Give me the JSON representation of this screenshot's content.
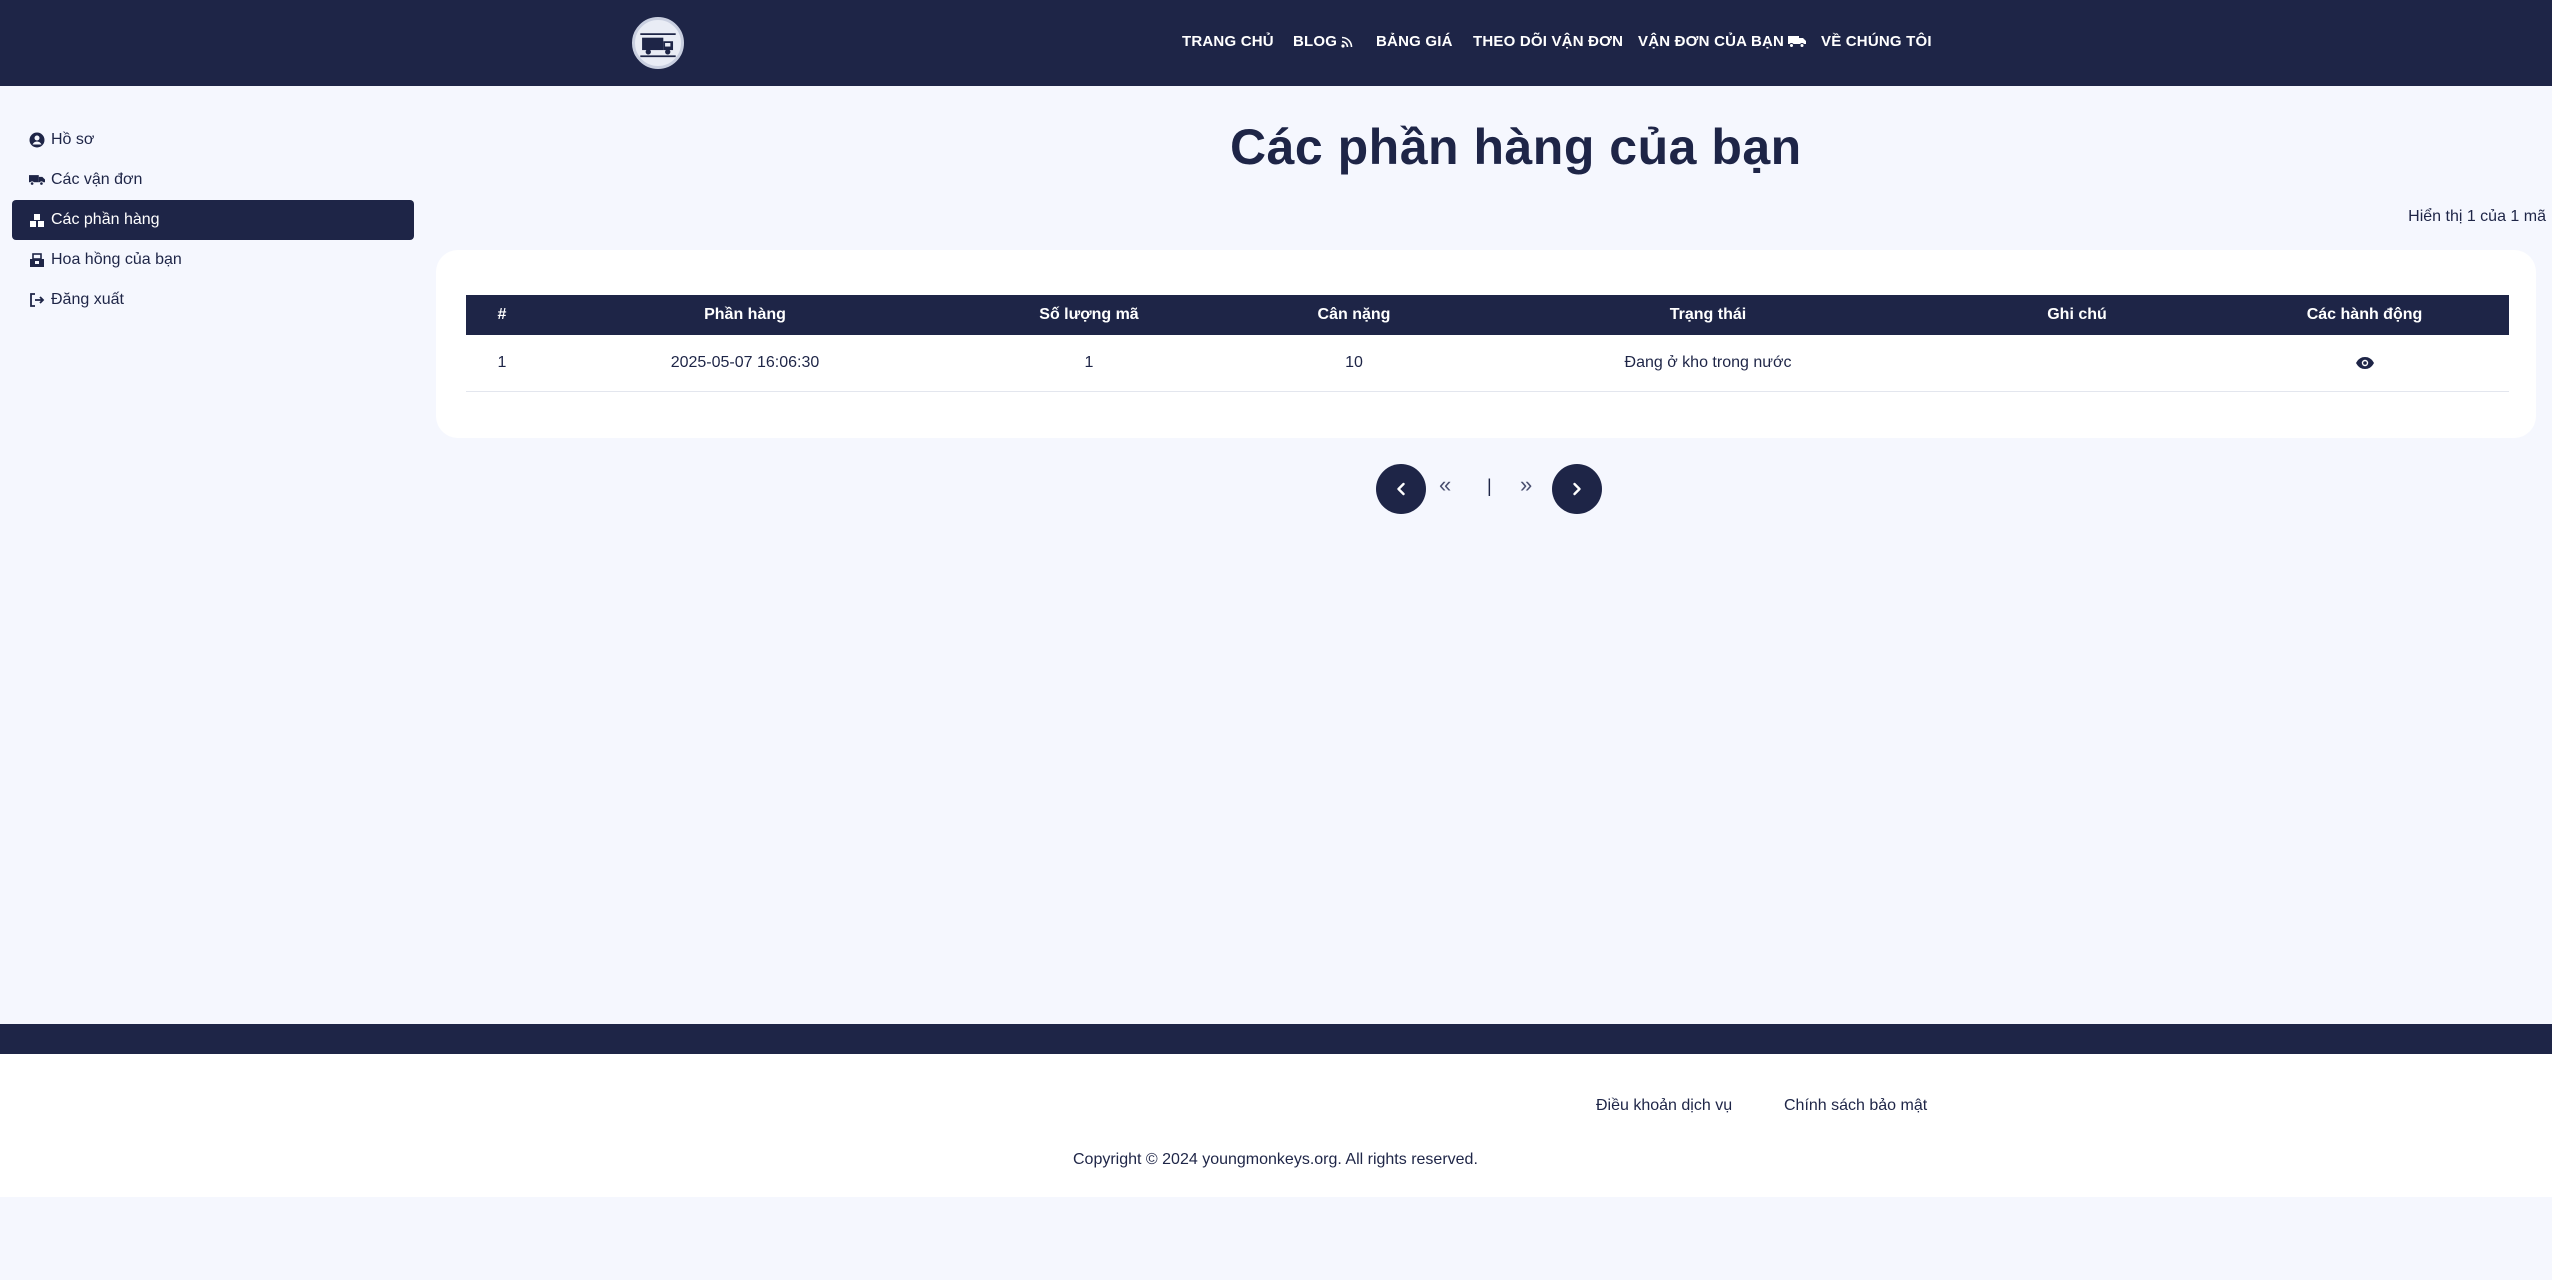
{
  "nav": {
    "items": [
      {
        "label": "TRANG CHỦ"
      },
      {
        "label": "BLOG"
      },
      {
        "label": "BẢNG GIÁ"
      },
      {
        "label": "THEO DÕI VẬN ĐƠN"
      },
      {
        "label": "VẬN ĐƠN CỦA BẠN"
      },
      {
        "label": "VỀ CHÚNG TÔI"
      }
    ]
  },
  "sidebar": {
    "items": [
      {
        "label": "Hồ sơ",
        "icon": "user-circle-icon"
      },
      {
        "label": "Các vận đơn",
        "icon": "truck-icon"
      },
      {
        "label": "Các phần hàng",
        "icon": "boxes-icon",
        "active": true
      },
      {
        "label": "Hoa hồng của bạn",
        "icon": "commission-icon"
      },
      {
        "label": "Đăng xuất",
        "icon": "logout-icon"
      }
    ]
  },
  "main": {
    "title": "Các phần hàng của bạn",
    "count_text": "Hiển thị 1 của 1 mã"
  },
  "table": {
    "headers": [
      "#",
      "Phần hàng",
      "Số lượng mã",
      "Cân nặng",
      "Trạng thái",
      "Ghi chú",
      "Các hành động"
    ],
    "rows": [
      {
        "index": "1",
        "shipment": "2025-05-07 16:06:30",
        "code_count": "1",
        "weight": "10",
        "status": "Đang ở kho trong nước",
        "note": ""
      }
    ]
  },
  "pagination": {
    "first": "«",
    "last": "»",
    "current": "|"
  },
  "footer": {
    "terms": "Điều khoản dịch vụ",
    "privacy": "Chính sách bảo mật",
    "copyright": "Copyright © 2024 youngmonkeys.org. All rights reserved."
  },
  "colors": {
    "primary": "#1e2547",
    "background": "#f5f7fe",
    "card": "#ffffff"
  }
}
